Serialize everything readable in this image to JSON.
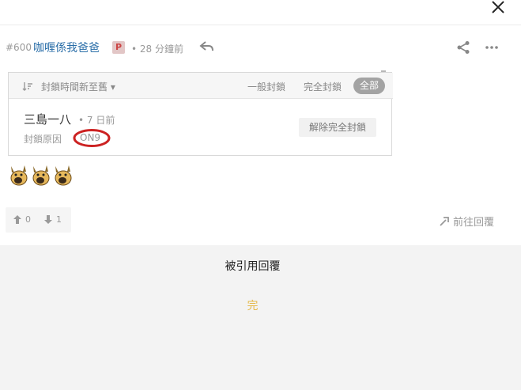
{
  "post": {
    "number": "#600",
    "username": "咖喱係我爸爸",
    "badge": "P",
    "time": "• 28 分鐘前"
  },
  "quote": {
    "sort_label": "封鎖時間新至舊 ▾",
    "filters": {
      "general": "一般封鎖",
      "full": "完全封鎖",
      "all": "全部"
    },
    "ban_entry": {
      "user": "三島一八",
      "time": "• 7 日前",
      "reason_label": "封鎖原因",
      "reason": "ON9",
      "unban_label": "解除完全封鎖"
    }
  },
  "votes": {
    "up": "0",
    "down": "1"
  },
  "goto_reply": "前往回覆",
  "bottom": {
    "title": "被引用回覆",
    "end_mark": "完"
  },
  "colors": {
    "username": "#2a6ea8",
    "annotation_red": "#cc2222",
    "end_mark": "#e5b94a"
  }
}
